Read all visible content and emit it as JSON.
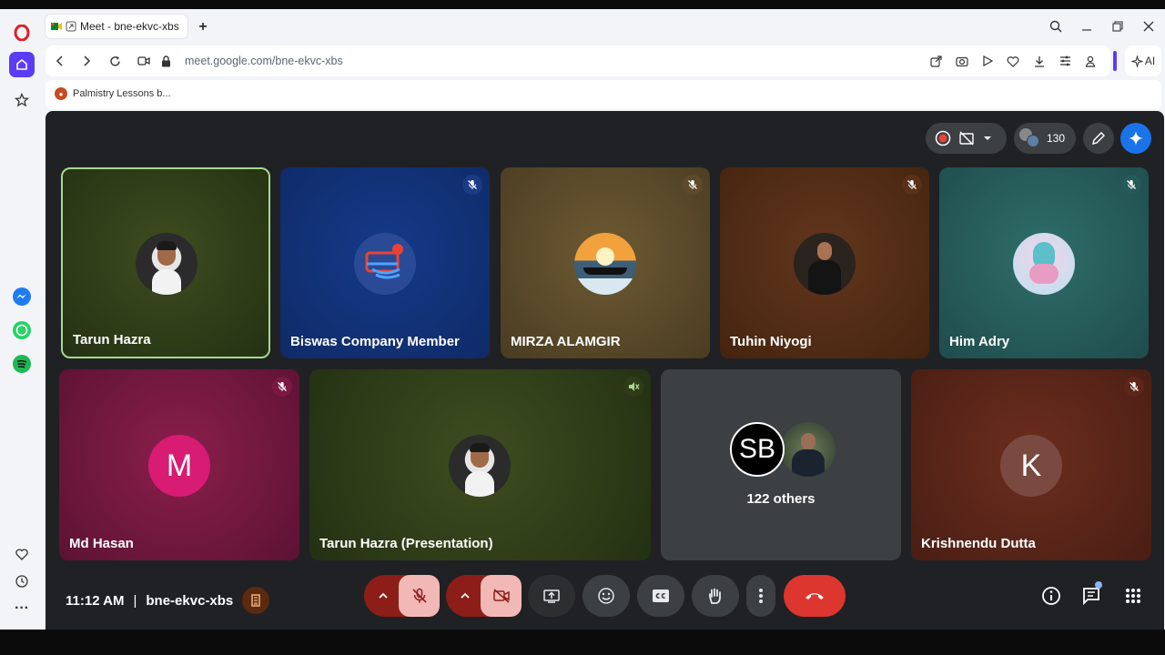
{
  "browser": {
    "tab_title": "Meet - bne-ekvc-xbs",
    "url_host": "meet.google.com",
    "url_path": "/bne-ekvc-xbs",
    "ai_label": "AI",
    "bookmark_label": "Palmistry Lessons b..."
  },
  "meet": {
    "participant_count": "130",
    "tiles": [
      {
        "name": "Tarun Hazra"
      },
      {
        "name": "Biswas Company Member"
      },
      {
        "name": "MIRZA ALAMGIR"
      },
      {
        "name": "Tuhin Niyogi"
      },
      {
        "name": "Him Adry"
      },
      {
        "name": "Md Hasan",
        "initial": "M"
      },
      {
        "name": "Tarun Hazra (Presentation)"
      },
      {
        "name": "",
        "initials": "SB",
        "others": "122 others"
      },
      {
        "name": "Krishnendu Dutta",
        "initial": "K"
      }
    ],
    "time": "11:12 AM",
    "separator": "|",
    "meeting_code": "bne-ekvc-xbs"
  },
  "colors": {
    "meet_bg": "#202124",
    "danger": "#ea4335",
    "highlight_border": "#a8d88c",
    "accent": "#8ab4f8"
  }
}
